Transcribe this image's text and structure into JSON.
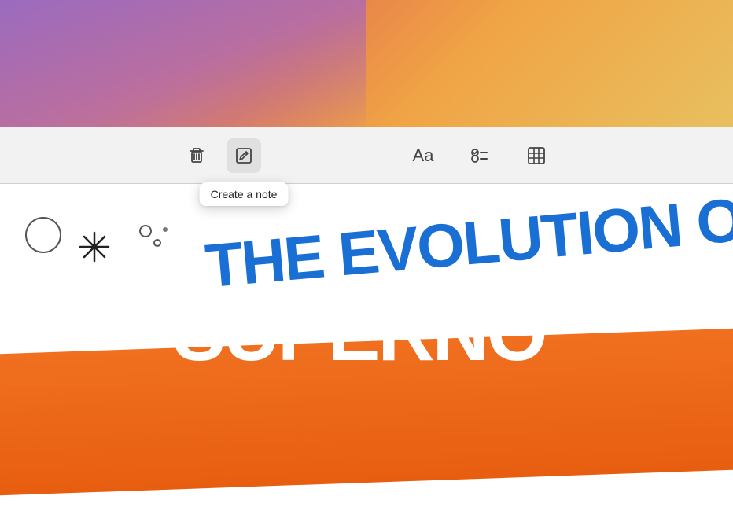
{
  "toolbar": {
    "tooltip_text": "Create a note",
    "delete_icon_name": "trash-icon",
    "compose_icon_name": "compose-icon",
    "font_icon_name": "font-icon",
    "font_label": "Aa",
    "checklist_icon_name": "checklist-icon",
    "table_icon_name": "table-icon",
    "compose_btn_name": "create-note-button",
    "delete_btn_name": "delete-button",
    "font_btn_name": "font-button",
    "checklist_btn_name": "checklist-button",
    "table_btn_name": "table-button"
  },
  "content": {
    "evolution_text": "THE EVOLUTION OF M",
    "supernova_text": "SUPERNO"
  }
}
